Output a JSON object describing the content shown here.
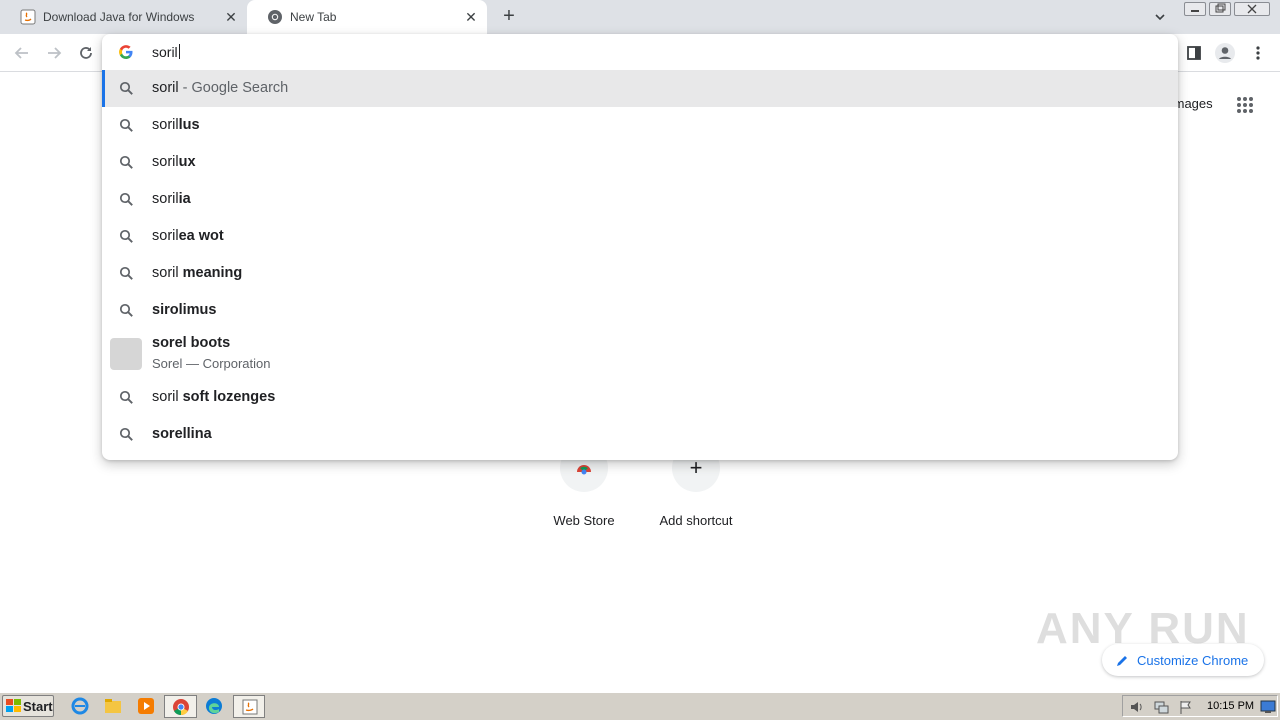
{
  "tabs": [
    {
      "title": "Download Java for Windows",
      "close": "✕"
    },
    {
      "title": "New Tab",
      "close": "✕"
    }
  ],
  "new_tab_symbol": "+",
  "omnibox": {
    "value": "soril",
    "suggestions": [
      {
        "plain": "soril",
        "bold": "",
        "suffix": " - Google Search",
        "selected": true
      },
      {
        "plain": "soril",
        "bold": "lus"
      },
      {
        "plain": "soril",
        "bold": "ux"
      },
      {
        "plain": "soril",
        "bold": "ia"
      },
      {
        "plain": "soril",
        "bold": "ea wot"
      },
      {
        "plain": "soril",
        "bold": " meaning"
      },
      {
        "plain": "",
        "bold": "sirolimus"
      },
      {
        "plain": "",
        "bold": "sorel boots",
        "subtitle": "Sorel — Corporation",
        "entity": true
      },
      {
        "plain": "soril",
        "bold": " soft lozenges"
      },
      {
        "plain": "",
        "bold": "sorellina"
      }
    ]
  },
  "ntp": {
    "images_link": "Images",
    "shortcuts": [
      {
        "label": "Web Store"
      },
      {
        "label": "Add shortcut",
        "symbol": "+"
      }
    ],
    "customize_label": "Customize Chrome"
  },
  "watermark": "ANY RUN",
  "taskbar": {
    "start_label": "Start",
    "clock": "10:15 PM"
  },
  "colors": {
    "accent": "#1a73e8",
    "tabstrip": "#dee1e6",
    "selected_row": "#e8e8e9"
  }
}
